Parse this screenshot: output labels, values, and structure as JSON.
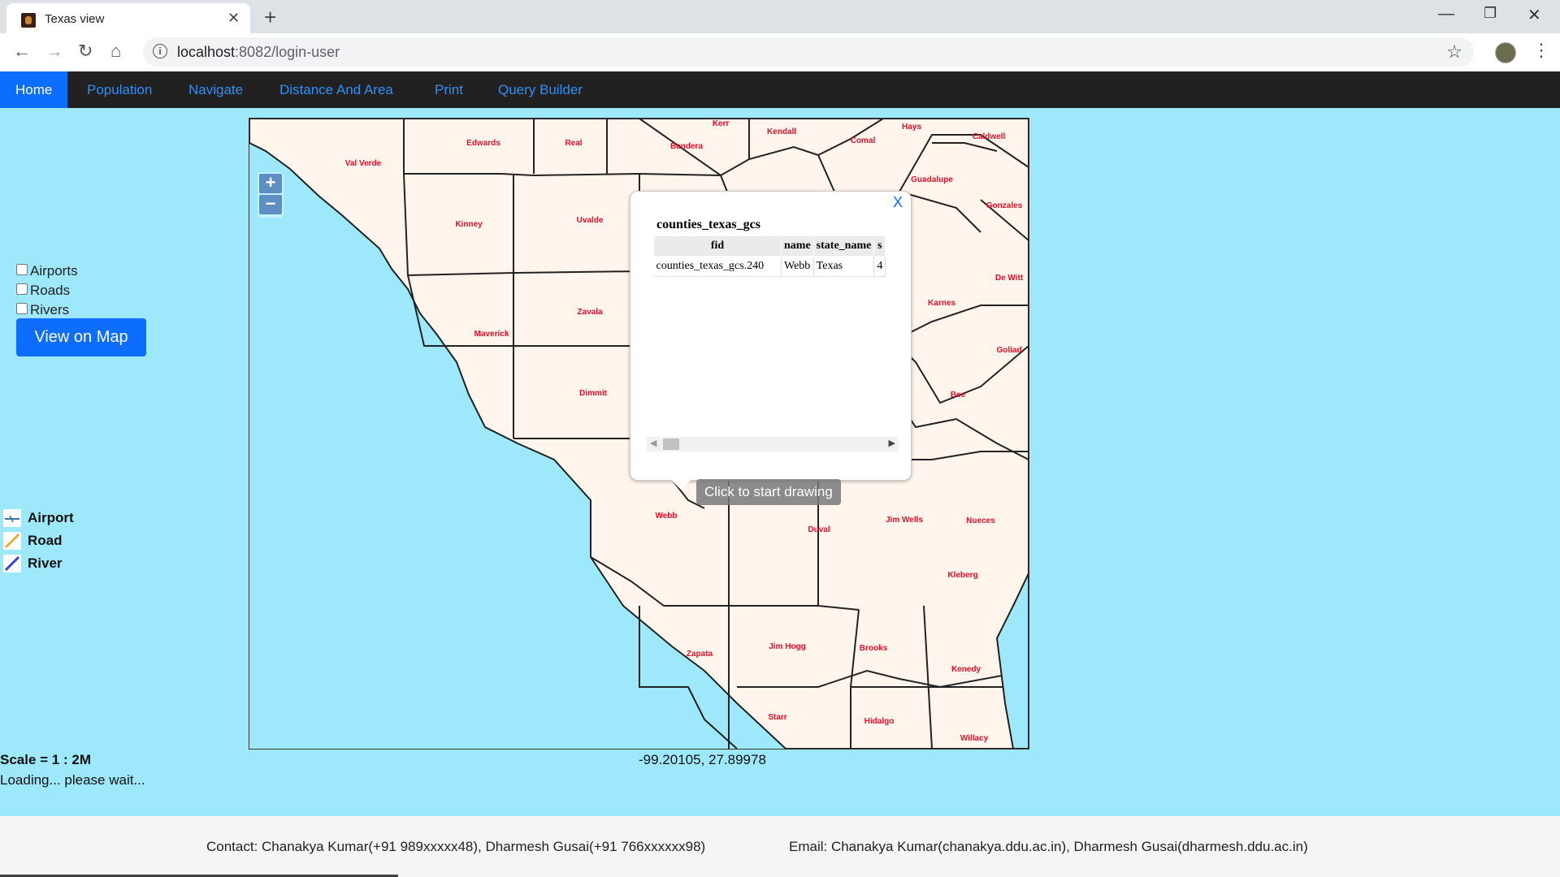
{
  "browser": {
    "tab_title": "Texas view",
    "url_host": "localhost",
    "url_rest": ":8082/login-user",
    "icons": [
      "back-icon",
      "forward-icon",
      "reload-icon",
      "home-icon",
      "info-icon",
      "star-icon",
      "menu-icon"
    ]
  },
  "nav": {
    "items": [
      "Home",
      "Population",
      "Navigate",
      "Distance And Area",
      "Print",
      "Query Builder"
    ],
    "active": "Home"
  },
  "layers": {
    "items": [
      {
        "label": "Airports",
        "checked": false
      },
      {
        "label": "Roads",
        "checked": false
      },
      {
        "label": "Rivers",
        "checked": false
      }
    ],
    "button": "View on Map"
  },
  "legend": {
    "items": [
      "Airport",
      "Road",
      "River"
    ]
  },
  "scale_text": "Scale = 1 : 2M",
  "loading_text": "Loading... please wait...",
  "coords_text": "-99.20105, 27.89978",
  "map": {
    "zoom_in": "+",
    "zoom_out": "−",
    "counties": [
      "Val Verde",
      "Edwards",
      "Real",
      "Kerr",
      "Bandera",
      "Kendall",
      "Comal",
      "Hays",
      "Caldwell",
      "Guadalupe",
      "Gonzales",
      "Kinney",
      "Uvalde",
      "Maverick",
      "Zavala",
      "Dimmit",
      "De Witt",
      "Karnes",
      "Goliad",
      "Bee",
      "Webb",
      "Duval",
      "Jim Wells",
      "Nueces",
      "Kleberg",
      "Zapata",
      "Jim Hogg",
      "Brooks",
      "Kenedy",
      "Starr",
      "Hidalgo",
      "Willacy"
    ],
    "label_color": "#e0102c",
    "land_color": "#fff5ec",
    "water_color": "#9ee8fb",
    "draw_tooltip": "Click to start drawing"
  },
  "popup": {
    "close": "X",
    "title": "counties_texas_gcs",
    "columns": [
      "fid",
      "name",
      "state_name",
      "s"
    ],
    "rows": [
      [
        "counties_texas_gcs.240",
        "Webb",
        "Texas",
        "4"
      ]
    ]
  },
  "footer": {
    "contact": "Contact: Chanakya Kumar(+91 989xxxxx48), Dharmesh Gusai(+91 766xxxxxx98)",
    "email": "Email: Chanakya Kumar(chanakya.ddu.ac.in), Dharmesh Gusai(dharmesh.ddu.ac.in)"
  }
}
